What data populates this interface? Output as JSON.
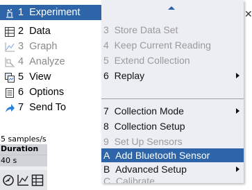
{
  "left_menu": {
    "items": [
      {
        "number": "1",
        "label": "Experiment",
        "icon": "experiment-icon",
        "selected": true,
        "disabled": false
      },
      {
        "number": "2",
        "label": "Data",
        "icon": "table-icon",
        "selected": false,
        "disabled": false
      },
      {
        "number": "3",
        "label": "Graph",
        "icon": "graph-icon",
        "selected": false,
        "disabled": true
      },
      {
        "number": "4",
        "label": "Analyze",
        "icon": "analyze-icon",
        "selected": false,
        "disabled": true
      },
      {
        "number": "5",
        "label": "View",
        "icon": "view-icon",
        "selected": false,
        "disabled": false
      },
      {
        "number": "6",
        "label": "Options",
        "icon": "options-icon",
        "selected": false,
        "disabled": false
      },
      {
        "number": "7",
        "label": "Send To",
        "icon": "send-icon",
        "selected": false,
        "disabled": false
      }
    ]
  },
  "submenu": {
    "items": [
      {
        "key": "3",
        "label": "Store Data Set",
        "disabled": true,
        "has_submenu": false,
        "selected": false
      },
      {
        "key": "4",
        "label": "Keep Current Reading",
        "disabled": true,
        "has_submenu": false,
        "selected": false
      },
      {
        "key": "5",
        "label": "Extend Collection",
        "disabled": true,
        "has_submenu": false,
        "selected": false
      },
      {
        "key": "6",
        "label": "Replay",
        "disabled": false,
        "has_submenu": true,
        "selected": false
      },
      {
        "key": "7",
        "label": "Collection Mode",
        "disabled": false,
        "has_submenu": true,
        "selected": false
      },
      {
        "key": "8",
        "label": "Collection Setup",
        "disabled": false,
        "has_submenu": false,
        "selected": false
      },
      {
        "key": "9",
        "label": "Set Up Sensors",
        "disabled": true,
        "has_submenu": false,
        "selected": false
      },
      {
        "key": "A",
        "label": "Add Bluetooth Sensor",
        "disabled": false,
        "has_submenu": false,
        "selected": true
      },
      {
        "key": "B",
        "label": "Advanced Setup",
        "disabled": false,
        "has_submenu": true,
        "selected": false
      },
      {
        "key": "C",
        "label": "Calibrate",
        "disabled": true,
        "has_submenu": false,
        "selected": false
      }
    ]
  },
  "background_panel": {
    "rate": "5 samples/s",
    "duration_label": "Duration",
    "duration_value": "40 s"
  },
  "toolbar": {
    "buttons": [
      "meter-icon",
      "graph-view-icon",
      "table-view-icon"
    ]
  },
  "colors": {
    "selection": "#2e65a8",
    "menu_bg": "#eceef3",
    "disabled_text": "#9a9a9a"
  }
}
